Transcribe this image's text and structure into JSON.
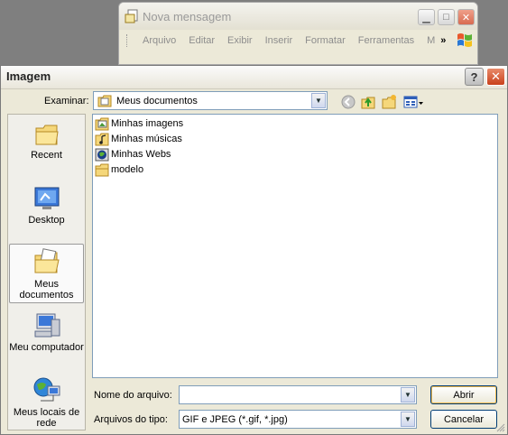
{
  "background_window": {
    "title": "Nova mensagem",
    "menu": [
      "Arquivo",
      "Editar",
      "Exibir",
      "Inserir",
      "Formatar",
      "Ferramentas",
      "M"
    ],
    "chevron": "»"
  },
  "dialog": {
    "title": "Imagem",
    "help_label": "?",
    "close_label": "✕",
    "look_in_label": "Examinar:",
    "look_in_value": "Meus documentos",
    "places": [
      {
        "label": "Recent",
        "icon": "recent-folder-icon"
      },
      {
        "label": "Desktop",
        "icon": "desktop-icon"
      },
      {
        "label": "Meus documentos",
        "icon": "my-documents-icon"
      },
      {
        "label": "Meu computador",
        "icon": "my-computer-icon"
      },
      {
        "label": "Meus locais de rede",
        "icon": "network-places-icon"
      }
    ],
    "files": [
      {
        "name": "Minhas imagens",
        "icon": "pictures-folder-icon"
      },
      {
        "name": "Minhas músicas",
        "icon": "music-folder-icon"
      },
      {
        "name": "Minhas Webs",
        "icon": "webs-folder-icon"
      },
      {
        "name": "modelo",
        "icon": "folder-icon"
      }
    ],
    "filename_label": "Nome do arquivo:",
    "filename_value": "",
    "filetype_label": "Arquivos do tipo:",
    "filetype_value": "GIF e JPEG (*.gif, *.jpg)",
    "open_label": "Abrir",
    "cancel_label": "Cancelar"
  }
}
